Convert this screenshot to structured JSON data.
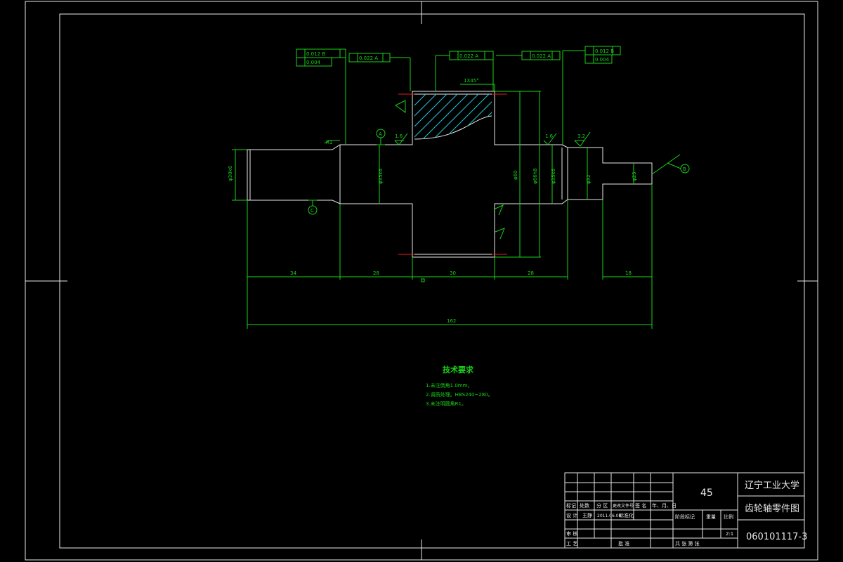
{
  "notes": {
    "title": "技术要求",
    "items": [
      "1.未注倒角1.0mm。",
      "2.调质处理。HBS240~280。",
      "3.未注明圆角R1。"
    ]
  },
  "title_block": {
    "marks": "标记",
    "count": "处数",
    "zone": "分 区",
    "change_doc": "更改文件号",
    "signature": "签 名",
    "date": "年、月、日",
    "design": "设 计",
    "designer": "王静",
    "design_date": "2011.06.08",
    "standardize": "标准化",
    "review": "审 核",
    "process": "工 艺",
    "approve": "批 准",
    "material": "45",
    "stage": "阶段标记",
    "weight": "重量",
    "scale_label": "比例",
    "scale": "2:1",
    "sheets": "共 张  第 张",
    "university": "辽宁工业大学",
    "part_name": "齿轮轴零件图",
    "drawing_number": "060101117-3"
  },
  "colors": {
    "geometry": "#e8e8e8",
    "dimensions": "#19d219",
    "pitch_line": "#e21b1b",
    "hatch": "#20c8d8",
    "background": "#000000"
  }
}
